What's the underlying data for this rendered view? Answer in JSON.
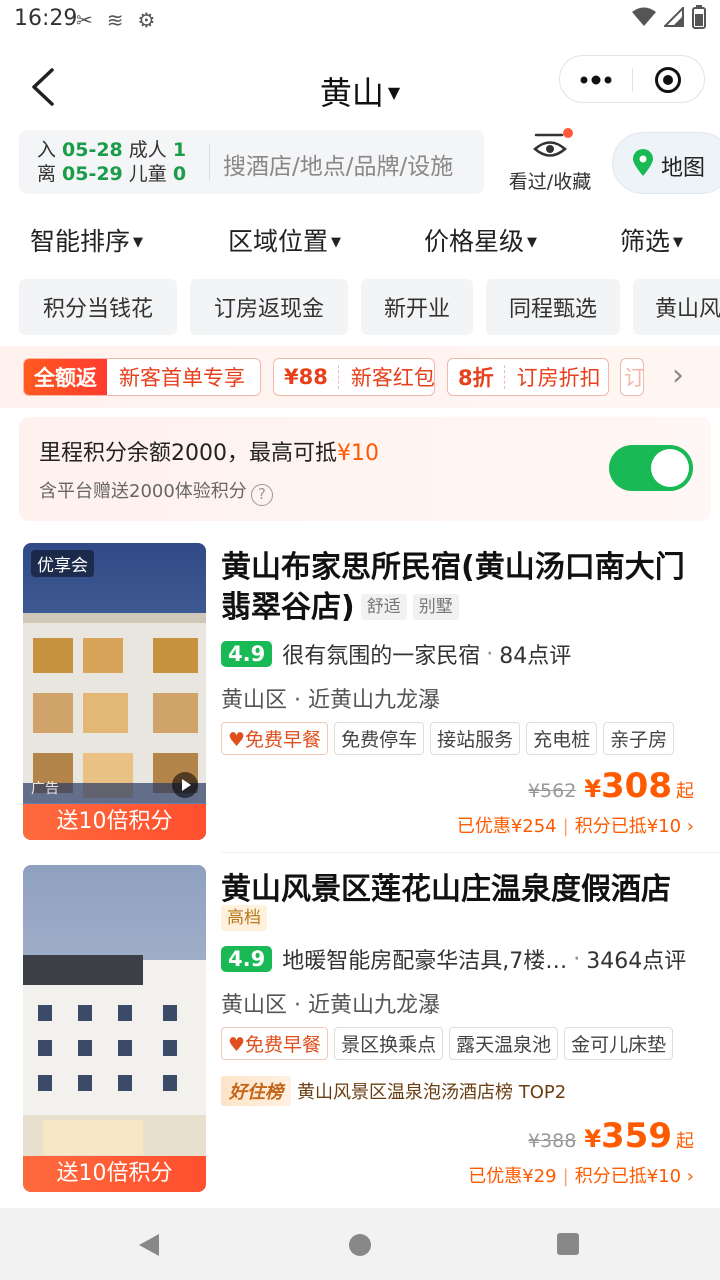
{
  "status_bar": {
    "time": "16:29"
  },
  "header": {
    "title": "黄山"
  },
  "search": {
    "checkin_label": "入",
    "checkin_date": "05-28",
    "adult_label": "成人",
    "adult_count": "1",
    "checkout_label": "离",
    "checkout_date": "05-29",
    "child_label": "儿童",
    "child_count": "0",
    "placeholder": "搜酒店/地点/品牌/设施"
  },
  "watched_label": "看过/收藏",
  "map_label": "地图",
  "sort_tabs": [
    "智能排序",
    "区域位置",
    "价格星级",
    "筛选"
  ],
  "tag_chips": [
    "积分当钱花",
    "订房返现金",
    "新开业",
    "同程甄选",
    "黄山风"
  ],
  "promos": [
    {
      "tag": "全额返",
      "text": "新客首单专享"
    },
    {
      "tag": "¥88",
      "text": "新客红包"
    },
    {
      "tag": "8折",
      "text": "订房折扣"
    },
    {
      "tag": "订",
      "text": ""
    }
  ],
  "points": {
    "main_prefix": "里程积分余额2000，最高可抵",
    "main_amount": "¥10",
    "sub": "含平台赠送2000体验积分",
    "help": "?",
    "toggle_on": true
  },
  "hotels": [
    {
      "name": "黄山布家思所民宿(黄山汤口南大门翡翠谷店)",
      "grade": "舒适",
      "type": "别墅",
      "score": "4.9",
      "review_text": "很有氛围的一家民宿",
      "review_count": "84点评",
      "location": "黄山区 · 近黄山九龙瀑",
      "amenities": [
        "免费早餐",
        "免费停车",
        "接站服务",
        "充电桩",
        "亲子房"
      ],
      "img_badge": "优享会",
      "ad": "广告",
      "img_strip": "送10倍积分",
      "orig_price": "¥562",
      "price_yen": "¥",
      "price": "308",
      "price_suffix": "起",
      "discount": "已优惠¥254",
      "points_deduct": "积分已抵¥10"
    },
    {
      "name": "黄山风景区莲花山庄温泉度假酒店",
      "grade": "高档",
      "score": "4.9",
      "review_text": "地暖智能房配豪华洁具,7楼…",
      "review_count": "3464点评",
      "location": "黄山区 · 近黄山九龙瀑",
      "amenities": [
        "免费早餐",
        "景区换乘点",
        "露天温泉池",
        "金可儿床垫"
      ],
      "rank_badge": "好住榜",
      "rank_text": "黄山风景区温泉泡汤酒店榜 TOP2",
      "img_strip": "送10倍积分",
      "orig_price": "¥388",
      "price_yen": "¥",
      "price": "359",
      "price_suffix": "起",
      "discount": "已优惠¥29",
      "points_deduct": "积分已抵¥10"
    }
  ],
  "colors": {
    "accent_green": "#19b955",
    "price_orange": "#ff5a00",
    "promo_red": "#e8401c"
  }
}
